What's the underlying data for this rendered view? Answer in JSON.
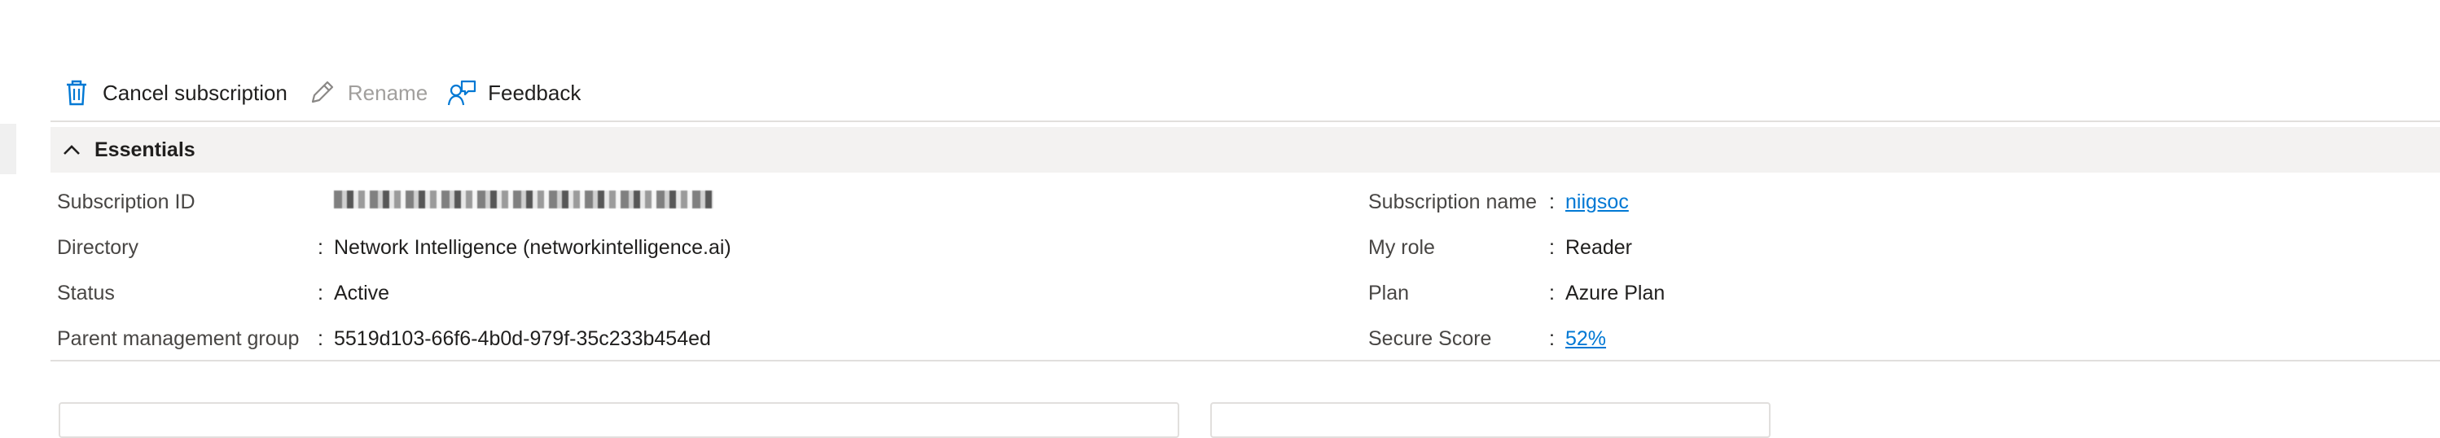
{
  "toolbar": {
    "cancel_label": "Cancel subscription",
    "rename_label": "Rename",
    "feedback_label": "Feedback"
  },
  "essentials": {
    "title": "Essentials",
    "left": [
      {
        "key": "Subscription ID",
        "value": "",
        "redacted": true
      },
      {
        "key": "Directory",
        "value": "Network Intelligence (networkintelligence.ai)"
      },
      {
        "key": "Status",
        "value": "Active"
      },
      {
        "key": "Parent management group",
        "value": "5519d103-66f6-4b0d-979f-35c233b454ed"
      }
    ],
    "right": [
      {
        "key": "Subscription name",
        "value": "niigsoc",
        "link": true
      },
      {
        "key": "My role",
        "value": "Reader"
      },
      {
        "key": "Plan",
        "value": "Azure Plan"
      },
      {
        "key": "Secure Score",
        "value": "52%",
        "link": true
      }
    ]
  },
  "colors": {
    "link": "#0078d4",
    "accent": "#0078d4",
    "essentials_bg": "#f3f2f1"
  }
}
